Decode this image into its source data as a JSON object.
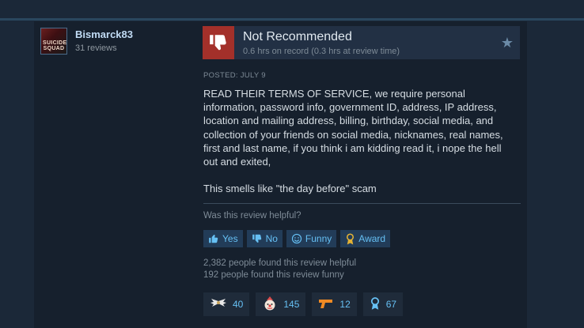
{
  "author": {
    "name": "Bismarck83",
    "reviews": "31 reviews",
    "avatar_text": "SUICIDE SQUAD"
  },
  "review": {
    "verdict": "Not Recommended",
    "hours": "0.6 hrs on record (0.3 hrs at review time)",
    "posted": "POSTED: JULY 9",
    "body": [
      "READ THEIR TERMS OF SERVICE, we require personal information, password info, government ID, address, IP address, location and mailing address, billing, birthday, social media, and collection of your friends on social media, nicknames, real names, first and last name, if you think i am kidding read it, i nope the hell out and exited,",
      "This smells like \"the day before\" scam"
    ],
    "verdict_color": "#a3302a"
  },
  "helpful": {
    "question": "Was this review helpful?",
    "yes_label": "Yes",
    "no_label": "No",
    "funny_label": "Funny",
    "award_label": "Award",
    "helpful_stat": "2,382 people found this review helpful",
    "funny_stat": "192 people found this review funny"
  },
  "awards": [
    {
      "icon": "wings-icon",
      "count": "40"
    },
    {
      "icon": "clown-icon",
      "count": "145"
    },
    {
      "icon": "gun-icon",
      "count": "12"
    },
    {
      "icon": "ribbon-icon",
      "count": "67"
    }
  ],
  "colors": {
    "background": "#1b2838",
    "accent": "#66c0f4",
    "card": "#16202d"
  }
}
